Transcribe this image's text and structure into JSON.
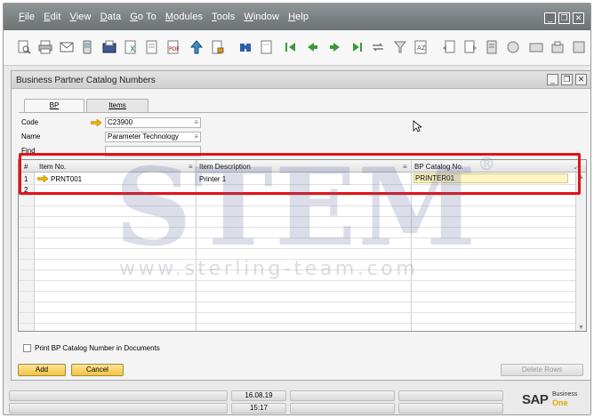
{
  "menu": [
    "File",
    "Edit",
    "View",
    "Data",
    "Go To",
    "Modules",
    "Tools",
    "Window",
    "Help"
  ],
  "window": {
    "title": "Business Partner Catalog Numbers",
    "tabs": [
      "BP",
      "Items"
    ]
  },
  "form": {
    "code_label": "Code",
    "code_value": "C23900",
    "name_label": "Name",
    "name_value": "Parameter Technology",
    "find_label": "Find",
    "find_value": ""
  },
  "grid": {
    "headers": [
      "#",
      "Item No.",
      "Item Description",
      "BP Catalog No."
    ],
    "rows": [
      {
        "num": "1",
        "item_no": "PRNT001",
        "description": "Printer 1",
        "catalog_no": "PRINTER01"
      },
      {
        "num": "2",
        "item_no": "",
        "description": "",
        "catalog_no": ""
      }
    ]
  },
  "checkbox_label": "Print BP Catalog Number in Documents",
  "buttons": {
    "add": "Add",
    "cancel": "Cancel",
    "delete_rows": "Delete Rows"
  },
  "status": {
    "date": "16.08.19",
    "time": "15:17"
  },
  "logo": {
    "sap": "SAP",
    "business": "Business",
    "one": "One"
  },
  "watermark": {
    "big": "STEM",
    "small": "www.sterling-team.com",
    "reg": "®"
  },
  "colors": {
    "highlight_box": "#e3121b",
    "selected_field": "#fff4c2",
    "button": "#f3c33f"
  }
}
